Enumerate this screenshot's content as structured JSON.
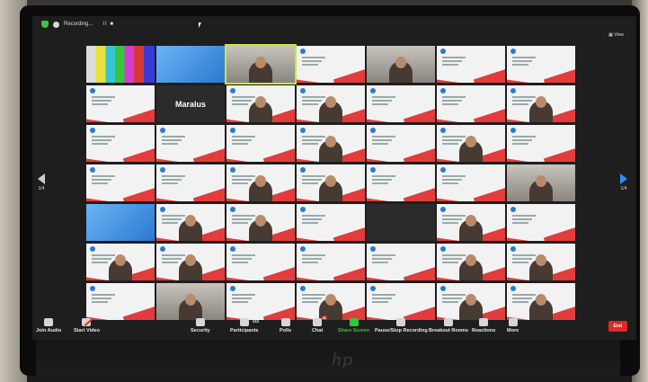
{
  "topbar": {
    "recording_label": "Recording...",
    "controls": "II ■",
    "view_label": "View"
  },
  "grid": {
    "tiles": [
      {
        "kind": "bars"
      },
      {
        "kind": "blue"
      },
      {
        "kind": "photo",
        "active": true
      },
      {
        "kind": "slide"
      },
      {
        "kind": "photo"
      },
      {
        "kind": "slide"
      },
      {
        "kind": "slide"
      },
      {
        "kind": "slide"
      },
      {
        "kind": "name",
        "name": "Maralus"
      },
      {
        "kind": "person"
      },
      {
        "kind": "person"
      },
      {
        "kind": "slide"
      },
      {
        "kind": "slide"
      },
      {
        "kind": "person"
      },
      {
        "kind": "slide"
      },
      {
        "kind": "slide"
      },
      {
        "kind": "slide"
      },
      {
        "kind": "person"
      },
      {
        "kind": "slide"
      },
      {
        "kind": "person"
      },
      {
        "kind": "slide"
      },
      {
        "kind": "slide"
      },
      {
        "kind": "slide"
      },
      {
        "kind": "person"
      },
      {
        "kind": "person"
      },
      {
        "kind": "slide"
      },
      {
        "kind": "slide"
      },
      {
        "kind": "photo"
      },
      {
        "kind": "blue"
      },
      {
        "kind": "person"
      },
      {
        "kind": "person"
      },
      {
        "kind": "slide"
      },
      {
        "kind": "dark"
      },
      {
        "kind": "person"
      },
      {
        "kind": "slide"
      },
      {
        "kind": "person"
      },
      {
        "kind": "person"
      },
      {
        "kind": "slide"
      },
      {
        "kind": "slide"
      },
      {
        "kind": "slide"
      },
      {
        "kind": "person"
      },
      {
        "kind": "person"
      },
      {
        "kind": "slide"
      },
      {
        "kind": "photo"
      },
      {
        "kind": "slide"
      },
      {
        "kind": "person"
      },
      {
        "kind": "slide"
      },
      {
        "kind": "person"
      },
      {
        "kind": "person"
      }
    ]
  },
  "nav": {
    "left_page": "1/4",
    "right_page": "1/4"
  },
  "toolbar": {
    "join_audio": "Join Audio",
    "start_video": "Start Video",
    "security": "Security",
    "participants": "Participants",
    "participants_count": "162",
    "polls": "Polls",
    "chat": "Chat",
    "chat_badge": "31",
    "share_screen": "Share Screen",
    "pause_stop_recording": "Pause/Stop Recording",
    "breakout_rooms": "Breakout Rooms",
    "reactions": "Reactions",
    "more": "More",
    "end": "End"
  },
  "laptop": {
    "brand": "hp"
  },
  "colors": {
    "accent_green": "#31c73b",
    "end_red": "#e02828",
    "slide_red": "#e23c3c",
    "next_arrow": "#2d8cff"
  }
}
